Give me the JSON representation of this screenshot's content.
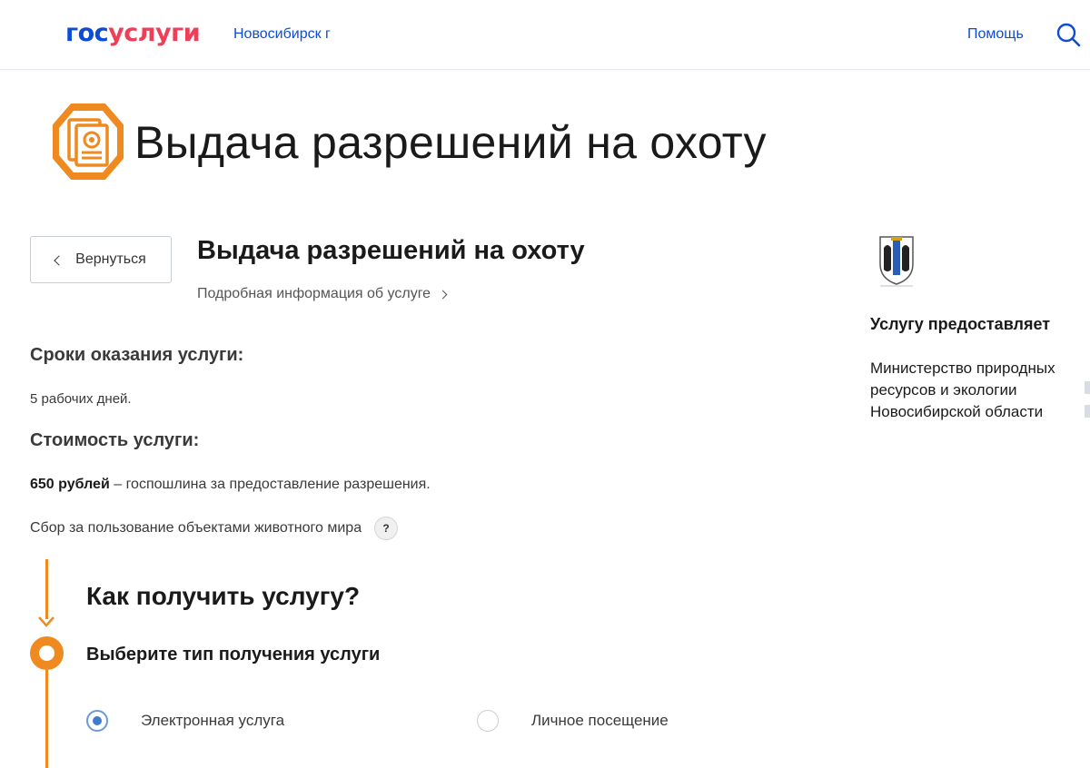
{
  "header": {
    "logo_part1": "гос",
    "logo_part2": "услуги",
    "region": "Новосибирск г",
    "help_label": "Помощь",
    "search_icon": "search-icon"
  },
  "page": {
    "title": "Выдача разрешений на охоту",
    "icon": "document-permit-icon"
  },
  "service": {
    "back_label": "Вернуться",
    "title": "Выдача разрешений на охоту",
    "more_info_label": "Подробная информация об услуге"
  },
  "terms": {
    "heading": "Сроки оказания услуги:",
    "text": "5 рабочих дней."
  },
  "cost": {
    "heading": "Стоимость услуги:",
    "amount": "650 рублей",
    "description": " – госпошлина за предоставление разрешения.",
    "fee_note": "Сбор за пользование объектами животного мира",
    "help_symbol": "?"
  },
  "how": {
    "title": "Как получить услугу?",
    "choose_title": "Выберите тип получения услуги",
    "options": [
      {
        "label": "Электронная услуга",
        "selected": true
      },
      {
        "label": "Личное посещение",
        "selected": false
      }
    ]
  },
  "provider": {
    "heading": "Услугу предоставляет",
    "name": "Министерство природных ресурсов и экологии Новосибирской области",
    "emblem": "region-emblem-icon"
  },
  "colors": {
    "brand_blue": "#0d4cd3",
    "brand_red": "#ee3f58",
    "accent_orange": "#ee8a1f",
    "radio_blue": "#3f7ccb"
  }
}
